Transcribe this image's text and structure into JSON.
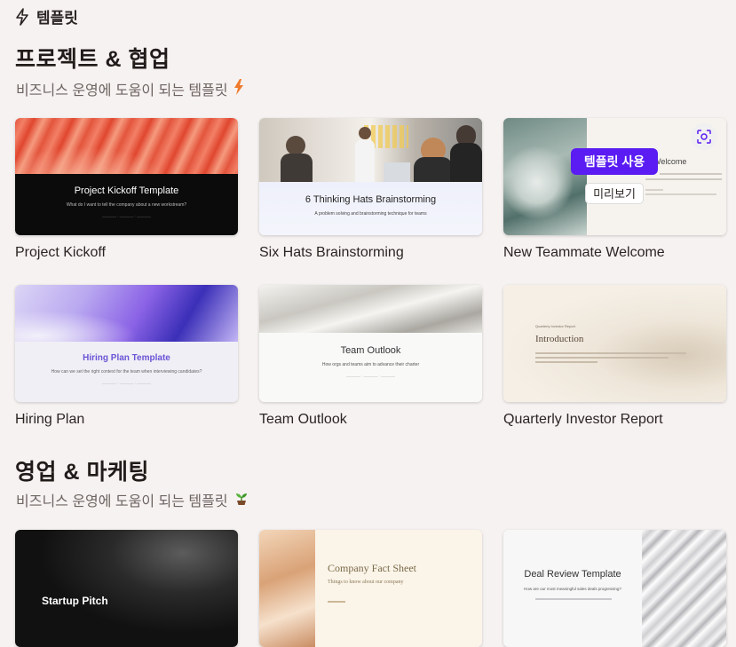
{
  "header": {
    "title": "템플릿",
    "icon": "bolt-icon"
  },
  "sections": [
    {
      "title": "프로젝트 & 협업",
      "subtitle": "비즈니스 운영에 도움이 되는 템플릿",
      "subtitle_icon": "lightning-emoji"
    },
    {
      "title": "영업 & 마케팅",
      "subtitle": "비즈니스 운영에 도움이 되는 템플릿",
      "subtitle_icon": "seedling-emoji"
    }
  ],
  "cards": {
    "project_kickoff": {
      "label": "Project Kickoff",
      "thumb_title": "Project Kickoff Template",
      "thumb_sub": "What do I want to tell the company about a new workstream?"
    },
    "six_hats": {
      "label": "Six Hats Brainstorming",
      "thumb_title": "6 Thinking Hats Brainstorming",
      "thumb_sub": "A problem solving and brainstorming technique for teams"
    },
    "new_teammate": {
      "label": "New Teammate Welcome",
      "thumb_title": "ate Welcome",
      "use_button": "템플릿 사용",
      "preview_button": "미리보기"
    },
    "hiring_plan": {
      "label": "Hiring Plan",
      "thumb_title": "Hiring Plan Template",
      "thumb_sub": "How can we set the right context for the team when interviewing candidates?"
    },
    "team_outlook": {
      "label": "Team Outlook",
      "thumb_title": "Team Outlook",
      "thumb_sub": "How orgs and teams aim to advance their charter"
    },
    "quarterly_investor": {
      "label": "Quarterly Investor Report",
      "thumb_kicker": "Quarterly Investor Report",
      "thumb_title": "Introduction"
    },
    "startup_pitch": {
      "thumb_title": "Startup Pitch"
    },
    "company_fact": {
      "thumb_title": "Company Fact Sheet",
      "thumb_sub": "Things to know about our company"
    },
    "deal_review": {
      "thumb_title": "Deal Review Template",
      "thumb_sub": "How are our most meaningful sales deals progressing?"
    }
  },
  "colors": {
    "accent": "#5a1cf2",
    "background": "#f6f2f1"
  }
}
